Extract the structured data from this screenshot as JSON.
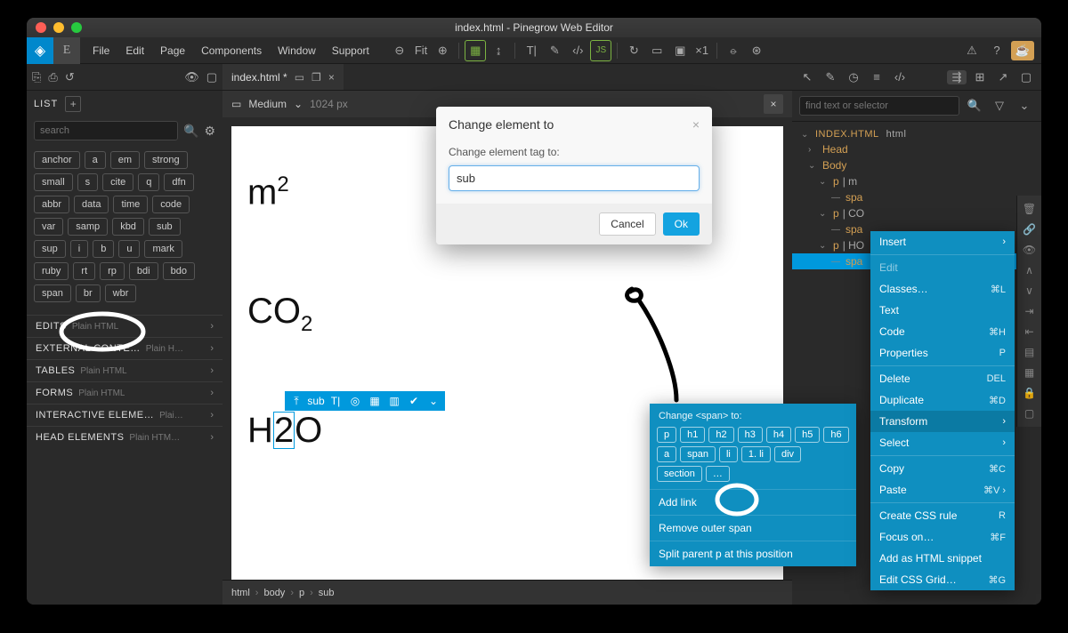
{
  "window": {
    "title": "index.html - Pinegrow Web Editor"
  },
  "menu": {
    "items": [
      "File",
      "Edit",
      "Page",
      "Components",
      "Window",
      "Support"
    ]
  },
  "toolbar": {
    "fit": "Fit",
    "multiplier": "×1"
  },
  "leftPanel": {
    "listLabel": "LIST",
    "searchPlaceholder": "search",
    "tags": [
      "anchor",
      "a",
      "em",
      "strong",
      "small",
      "s",
      "cite",
      "q",
      "dfn",
      "abbr",
      "data",
      "time",
      "code",
      "var",
      "samp",
      "kbd",
      "sub",
      "sup",
      "i",
      "b",
      "u",
      "mark",
      "ruby",
      "rt",
      "rp",
      "bdi",
      "bdo",
      "span",
      "br",
      "wbr"
    ],
    "sections": [
      {
        "title": "EDITS",
        "sub": "Plain HTML"
      },
      {
        "title": "EXTERNAL CONTE…",
        "sub": "Plain H…"
      },
      {
        "title": "TABLES",
        "sub": "Plain HTML"
      },
      {
        "title": "FORMS",
        "sub": "Plain HTML"
      },
      {
        "title": "INTERACTIVE ELEME…",
        "sub": "Plai…"
      },
      {
        "title": "HEAD ELEMENTS",
        "sub": "Plain HTM…"
      }
    ]
  },
  "tabs": {
    "fileName": "index.html *"
  },
  "viewport": {
    "sizeLabel": "Medium",
    "px": "1024 px"
  },
  "canvas": {
    "formula1_html": "m<sup>2</sup>",
    "formula2_html": "CO<sub>2</sub>",
    "formula3_pre": "H",
    "formula3_sel": "2",
    "formula3_post": "O",
    "selToolbarTag": "sub"
  },
  "breadcrumb": [
    "html",
    "body",
    "p",
    "sub"
  ],
  "dialog": {
    "title": "Change element to",
    "label": "Change element tag to:",
    "value": "sub",
    "cancel": "Cancel",
    "ok": "Ok"
  },
  "ctxBlue": {
    "header": "Change <span> to:",
    "tags": [
      "p",
      "h1",
      "h2",
      "h3",
      "h4",
      "h5",
      "h6",
      "a",
      "span",
      "li",
      "1. li",
      "div",
      "section",
      "…"
    ],
    "rows": [
      "Add link",
      "Remove outer span",
      "Split parent p at this position"
    ]
  },
  "rightPanel": {
    "searchPlaceholder": "find text or selector",
    "fileRow": "INDEX.HTML",
    "fileTag": "html",
    "treeRows": [
      {
        "lvl": 1,
        "chev": "›",
        "label": "Head"
      },
      {
        "lvl": 1,
        "chev": "⌄",
        "label": "Body"
      },
      {
        "lvl": 2,
        "chev": "⌄",
        "label": "p",
        "suffix": " | m"
      },
      {
        "lvl": 3,
        "chev": "—",
        "label": "spa"
      },
      {
        "lvl": 2,
        "chev": "⌄",
        "label": "p",
        "suffix": " | CO"
      },
      {
        "lvl": 3,
        "chev": "—",
        "label": "spa"
      },
      {
        "lvl": 2,
        "chev": "⌄",
        "label": "p",
        "suffix": " | HO"
      },
      {
        "lvl": 3,
        "chev": "—",
        "label": "spa",
        "sel": true
      }
    ]
  },
  "ctxTree": {
    "groups": [
      [
        {
          "t": "Insert",
          "chev": true
        }
      ],
      [
        {
          "t": "Edit",
          "disabled": true
        },
        {
          "t": "Classes…",
          "sc": "⌘L"
        },
        {
          "t": "Text"
        },
        {
          "t": "Code",
          "sc": "⌘H"
        },
        {
          "t": "Properties",
          "sc": "P"
        }
      ],
      [
        {
          "t": "Delete",
          "sc": "DEL"
        },
        {
          "t": "Duplicate",
          "sc": "⌘D"
        },
        {
          "t": "Transform",
          "chev": true,
          "sel": true
        },
        {
          "t": "Select",
          "chev": true
        }
      ],
      [
        {
          "t": "Copy",
          "sc": "⌘C"
        },
        {
          "t": "Paste",
          "sc": "⌘V ›"
        }
      ],
      [
        {
          "t": "Create CSS rule",
          "sc": "R"
        },
        {
          "t": "Focus on…",
          "sc": "⌘F"
        },
        {
          "t": "Add as HTML snippet"
        },
        {
          "t": "Edit CSS Grid…",
          "sc": "⌘G"
        }
      ]
    ]
  }
}
